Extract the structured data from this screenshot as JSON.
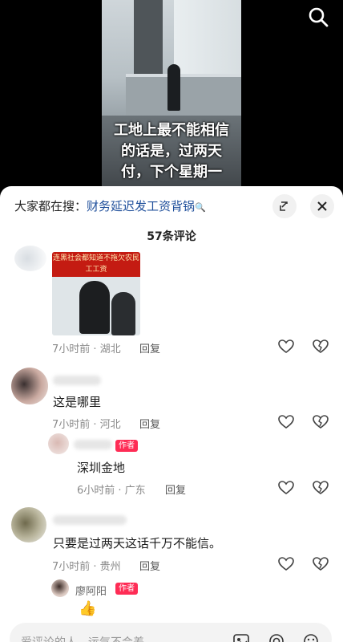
{
  "video": {
    "caption_line1": "工地上最不能相信",
    "caption_line2": "的话是，过两天",
    "caption_line3": "付，下个星期一"
  },
  "sheet": {
    "hot_prefix": "大家都在搜：",
    "hot_keyword": "财务延迟发工资背锅",
    "comment_count": "57条评论"
  },
  "comments": [
    {
      "meta": "7小时前 · 湖北",
      "reply_label": "回复",
      "image_banner": "连黑社会都知道不拖欠农民工工资"
    },
    {
      "text": "这是哪里",
      "meta": "7小时前 · 河北",
      "reply_label": "回复"
    },
    {
      "badge": "作者",
      "text": "深圳金地",
      "meta": "6小时前 · 广东",
      "reply_label": "回复"
    },
    {
      "text": "只要是过两天这话千万不能信。",
      "meta": "7小时前 · 贵州",
      "reply_label": "回复"
    },
    {
      "name": "廖阿阳",
      "badge": "作者",
      "text": "👍"
    }
  ],
  "input": {
    "placeholder": "爱评论的人，运气不会差"
  },
  "colors": {
    "accent": "#fe2c55",
    "keyword": "#1f4f9b"
  }
}
